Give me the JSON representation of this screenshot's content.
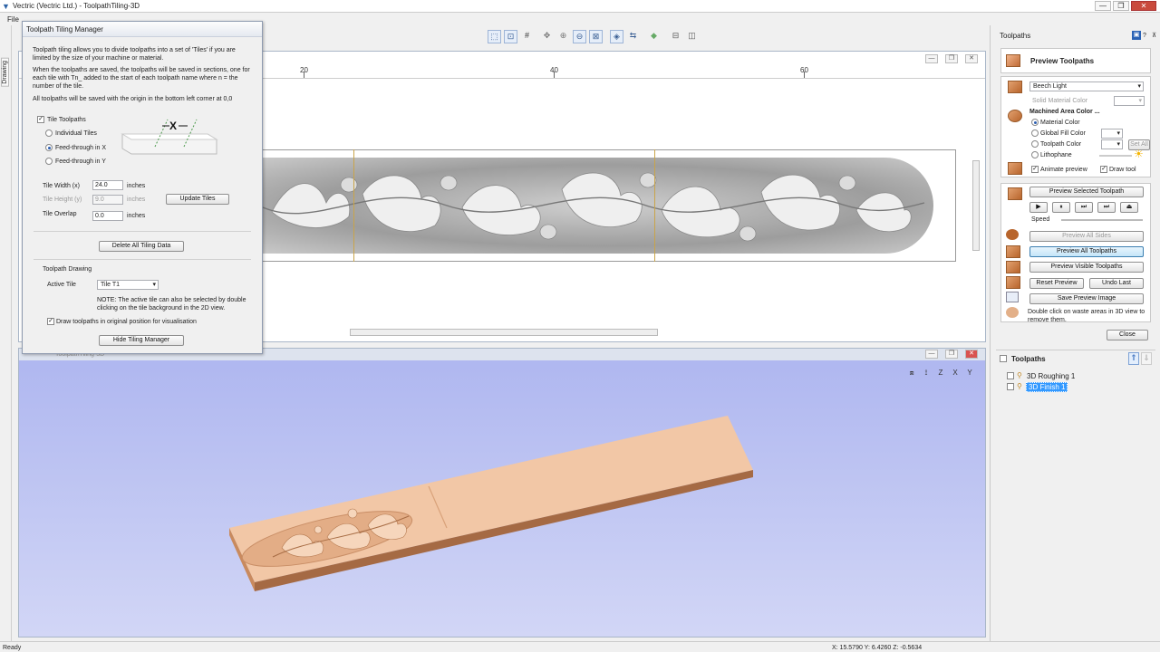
{
  "window": {
    "title": "Vectric (Vectric Ltd.) - ToolpathTiling-3D",
    "controls": [
      "—",
      "❐",
      "✕"
    ]
  },
  "menu": {
    "items": [
      "File"
    ]
  },
  "left_tab": {
    "label": "Drawing"
  },
  "toolbar": {
    "icons": [
      "zoom-box-icon",
      "zoom-fit-icon",
      "grid-icon",
      "pan-icon",
      "zoom-in-icon",
      "zoom-out-icon",
      "zoom-selection-icon",
      "snap-icon",
      "measure-icon",
      "layer-icon",
      "split-horizontal-icon",
      "split-vertical-icon"
    ]
  },
  "view2d": {
    "ruler_labels": [
      "20",
      "40",
      "60"
    ]
  },
  "view3d": {
    "title": "ToolpathTiling-3D"
  },
  "dialog": {
    "title": "Toolpath Tiling Manager",
    "intro1": "Toolpath tiling allows you to divide toolpaths into a set of 'Tiles' if you are limited by the size of your machine or material.",
    "intro2": "When the toolpaths are saved, the toolpaths will be saved in sections, one for each tile with Tn_ added to the start of each toolpath name where n = the number of the tile.",
    "intro3": "All toolpaths will be saved with the origin in the bottom left corner at 0,0",
    "tile_toolpaths_label": "Tile Toolpaths",
    "tile_toolpaths_checked": true,
    "options": [
      {
        "label": "Individual Tiles",
        "selected": false
      },
      {
        "label": "Feed-through in X",
        "selected": true
      },
      {
        "label": "Feed-through in Y",
        "selected": false
      }
    ],
    "tile_width_label": "Tile Width (x)",
    "tile_width_value": "24.0",
    "tile_height_label": "Tile Height (y)",
    "tile_height_value": "9.0",
    "tile_overlap_label": "Tile Overlap",
    "tile_overlap_value": "0.0",
    "unit": "inches",
    "update_tiles": "Update Tiles",
    "delete_all": "Delete All Tiling Data",
    "drawing_section": "Toolpath Drawing",
    "active_tile_label": "Active Tile",
    "active_tile_value": "Tile T1",
    "note": "NOTE: The active tile can also be selected by double clicking on the tile background in the 2D view.",
    "draw_original_label": "Draw toolpaths in original position for visualisation",
    "draw_original_checked": true,
    "hide_button": "Hide Tiling Manager"
  },
  "right_panel": {
    "header": "Toolpaths",
    "preview_title": "Preview Toolpaths",
    "material": "Beech Light",
    "solid_material_color": "Solid Material Color",
    "machined_area_color": "Machined Area Color ...",
    "color_options": [
      {
        "label": "Material Color",
        "selected": true
      },
      {
        "label": "Global Fill Color",
        "selected": false
      },
      {
        "label": "Toolpath Color",
        "selected": false
      },
      {
        "label": "Lithophane",
        "selected": false
      }
    ],
    "set_all": "Set All",
    "animate_preview": "Animate preview",
    "draw_tool": "Draw tool",
    "preview_selected": "Preview Selected Toolpath",
    "speed": "Speed",
    "preview_all_sides": "Preview All Sides",
    "preview_all": "Preview All Toolpaths",
    "preview_visible": "Preview Visible Toolpaths",
    "reset_preview": "Reset Preview",
    "undo_last": "Undo Last",
    "save_image": "Save Preview Image",
    "hint": "Double click on waste areas in 3D view to remove them.",
    "close": "Close",
    "toolpaths_section": "Toolpaths",
    "toolpath_items": [
      "3D Roughing 1",
      "3D Finish 1"
    ]
  },
  "status": {
    "left": "Ready",
    "coords": "X: 15.5790 Y: 6.4260 Z: -0.5634"
  },
  "colors": {
    "accent": "#3399ff",
    "wood": "#e8b28a",
    "background3d": "#c3c9f3"
  }
}
